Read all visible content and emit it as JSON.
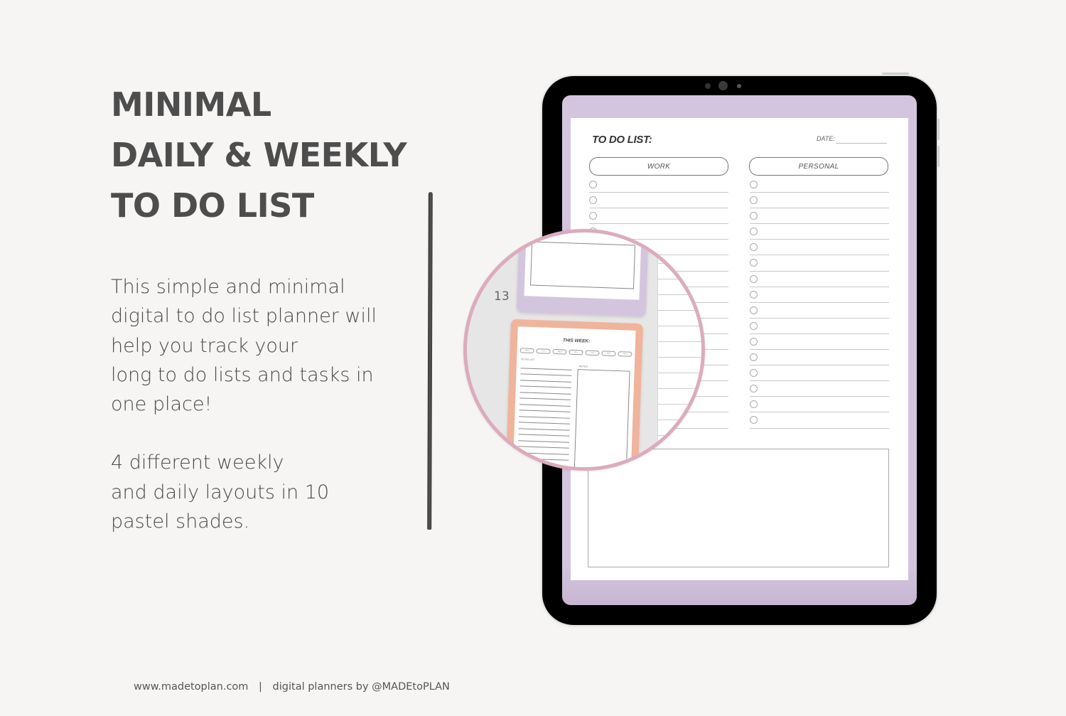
{
  "headline": {
    "lines": [
      "MINIMAL",
      "DAILY & WEEKLY",
      "TO DO LIST"
    ]
  },
  "description": {
    "paragraph1": [
      "This simple and minimal",
      "digital to do list planner will",
      "help you track your",
      "long to do lists and tasks in",
      "one place!"
    ],
    "paragraph2": [
      "4 different weekly",
      "and daily layouts in 10",
      "pastel shades."
    ]
  },
  "footer": {
    "website": "www.madetoplan.com",
    "separator": "|",
    "credit": "digital planners by @MADEtoPLAN"
  },
  "planner_page": {
    "title": "TO DO LIST:",
    "date_label": "DATE:",
    "columns": [
      {
        "label": "WORK",
        "row_count": 16
      },
      {
        "label": "PERSONAL",
        "row_count": 16
      }
    ],
    "screen_color": "#d4c5df"
  },
  "magnifier": {
    "page_number": "13",
    "weekly_thumbnail": {
      "title": "THIS WEEK:",
      "days": [
        "MON",
        "TUE",
        "WED",
        "THU",
        "FRI",
        "SAT",
        "SUN"
      ],
      "todo_label": "TO DO LIST",
      "notes_label": "NOTES",
      "color": "#efb49b"
    },
    "daily_thumbnail_color": "#d4c5df",
    "ring_color": "#dcabbd"
  }
}
